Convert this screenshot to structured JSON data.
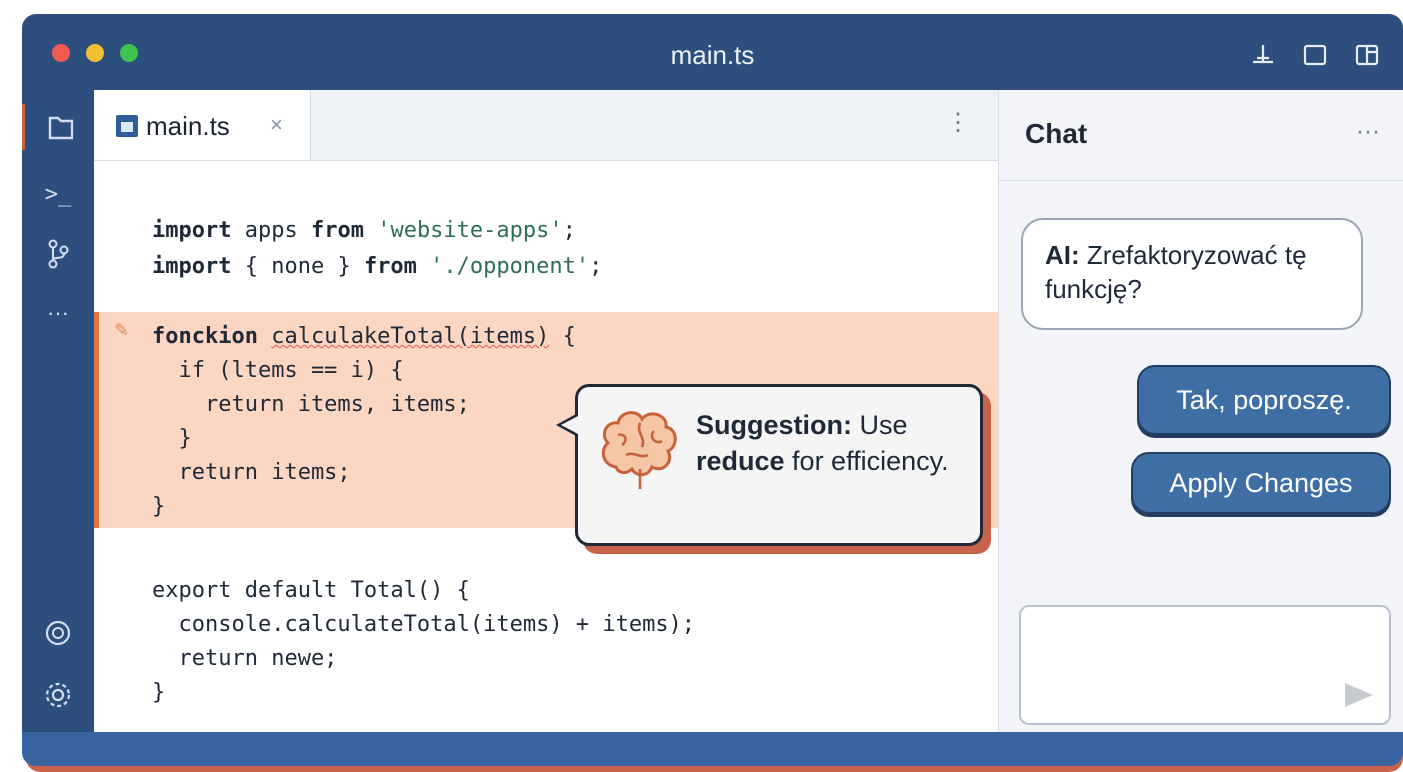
{
  "window": {
    "title": "main.ts",
    "colors": {
      "frame": "#2d4f7d",
      "accent": "#e0773f",
      "highlight": "#fbd6c2",
      "button": "#3e6ea4"
    }
  },
  "titlebar_icons": [
    "layout-icon",
    "split-square-icon",
    "panel-icon"
  ],
  "activity_bar": {
    "items": [
      "explorer-icon",
      "terminal-icon",
      "source-control-icon",
      "more-icon"
    ],
    "bottom_items": [
      "account-icon",
      "settings-icon"
    ],
    "more_label": "···",
    "terminal_label": ">_"
  },
  "editor": {
    "tab": {
      "label": "main.ts",
      "close": "×"
    },
    "tab_more": "⋮",
    "code": {
      "l1": {
        "kw1": "import",
        "t1": " apps ",
        "kw2": "from",
        "t2": " ",
        "s": "'website-apps'",
        "t3": ";"
      },
      "l2": {
        "kw1": "import",
        "t1": " { none } ",
        "kw2": "from",
        "t2": " ",
        "s": "'./opponent'",
        "t3": ";"
      },
      "l3": {
        "kw1": "fonckion",
        "t1": " ",
        "fn": "calculakeTotal(items)",
        "t2": " {"
      },
      "l4": "  if (ltems == i) {",
      "l5": "    return items, items;",
      "l6": "  }",
      "l7": "  return items;",
      "l8": "}",
      "l9": "export default Total() {",
      "l10": "  console.calculateTotal(items) + items);",
      "l11": "  return newe;",
      "l12": "}"
    }
  },
  "suggestion": {
    "label": "Suggestion:",
    "t1": " Use ",
    "keyword": "reduce",
    "t2": " for efficiency."
  },
  "chat": {
    "title": "Chat",
    "more": "···",
    "ai_label": "AI:",
    "ai_text": " Zrefaktoryzować tę funkcję?",
    "yes_button": "Tak, poproszę.",
    "apply_button": "Apply Changes",
    "input_value": ""
  }
}
